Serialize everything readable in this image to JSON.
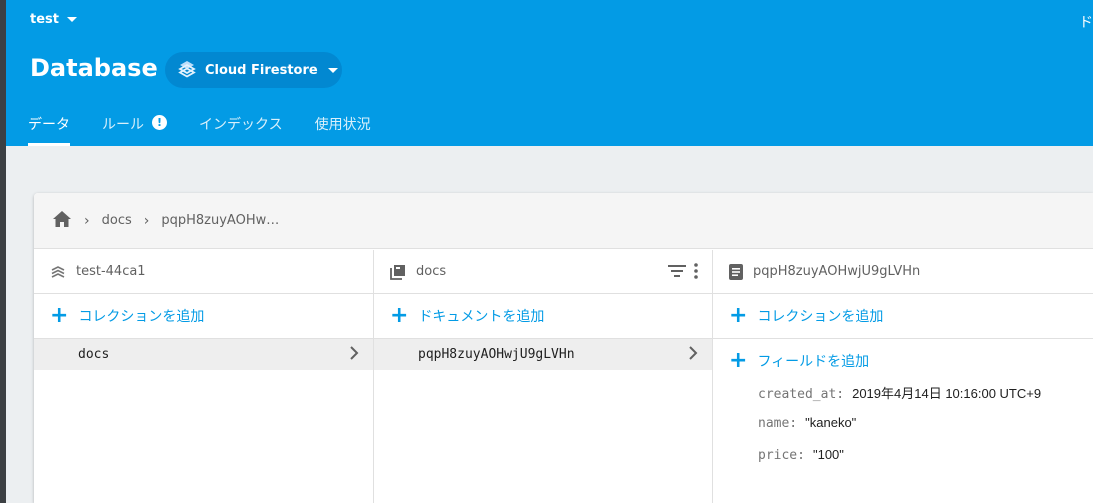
{
  "header": {
    "project": "test",
    "top_right_text": "ド",
    "title": "Database",
    "db_selector": "Cloud Firestore",
    "tabs": [
      {
        "label": "データ"
      },
      {
        "label": "ルール",
        "badge": "!"
      },
      {
        "label": "インデックス"
      },
      {
        "label": "使用状況"
      }
    ]
  },
  "breadcrumb": [
    "docs",
    "pqpH8zuyAOHw…"
  ],
  "columns": {
    "root": {
      "title": "test-44ca1",
      "add_label": "コレクションを追加",
      "items": [
        "docs"
      ]
    },
    "collection": {
      "title": "docs",
      "add_label": "ドキュメントを追加",
      "items": [
        "pqpH8zuyAOHwjU9gLVHn"
      ]
    },
    "document": {
      "title": "pqpH8zuyAOHwjU9gLVHn",
      "add_collection_label": "コレクションを追加",
      "add_field_label": "フィールドを追加",
      "fields": [
        {
          "key": "created_at:",
          "value": "2019年4月14日 10:16:00 UTC+9"
        },
        {
          "key": "name:",
          "value": "\"kaneko\""
        },
        {
          "key": "price:",
          "value": "\"100\""
        }
      ]
    }
  },
  "colors": {
    "header_bg": "#039be5",
    "accent": "#039be5",
    "selected_row": "#eeeeee"
  }
}
